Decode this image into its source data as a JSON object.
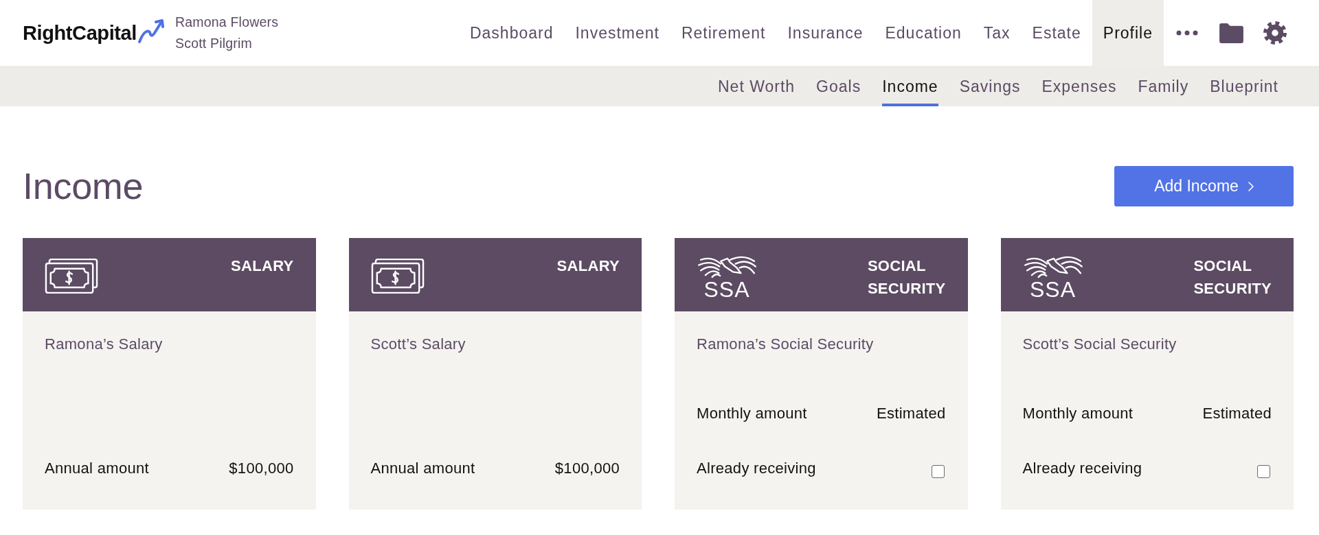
{
  "header": {
    "logo": "RightCapital",
    "clients": [
      "Ramona Flowers",
      "Scott Pilgrim"
    ],
    "nav": [
      {
        "label": "Dashboard",
        "selected": false
      },
      {
        "label": "Investment",
        "selected": false
      },
      {
        "label": "Retirement",
        "selected": false
      },
      {
        "label": "Insurance",
        "selected": false
      },
      {
        "label": "Education",
        "selected": false
      },
      {
        "label": "Tax",
        "selected": false
      },
      {
        "label": "Estate",
        "selected": false
      },
      {
        "label": "Profile",
        "selected": true
      }
    ]
  },
  "subnav": [
    {
      "label": "Net Worth",
      "selected": false
    },
    {
      "label": "Goals",
      "selected": false
    },
    {
      "label": "Income",
      "selected": true
    },
    {
      "label": "Savings",
      "selected": false
    },
    {
      "label": "Expenses",
      "selected": false
    },
    {
      "label": "Family",
      "selected": false
    },
    {
      "label": "Blueprint",
      "selected": false
    }
  ],
  "page": {
    "title": "Income",
    "add_button": "Add Income"
  },
  "cards": [
    {
      "kind": "salary",
      "type_label": "SALARY",
      "name": "Ramona’s Salary",
      "rows": [
        {
          "kind": "value",
          "label": "Annual amount",
          "value": "$100,000"
        }
      ]
    },
    {
      "kind": "salary",
      "type_label": "SALARY",
      "name": "Scott’s Salary",
      "rows": [
        {
          "kind": "value",
          "label": "Annual amount",
          "value": "$100,000"
        }
      ]
    },
    {
      "kind": "social_security",
      "type_label": "SOCIAL SECURITY",
      "logo_text": "SSA",
      "name": "Ramona’s Social Security",
      "rows": [
        {
          "kind": "value",
          "label": "Monthly amount",
          "value": "Estimated"
        },
        {
          "kind": "checkbox",
          "label": "Already receiving",
          "checked": false
        }
      ]
    },
    {
      "kind": "social_security",
      "type_label": "SOCIAL SECURITY",
      "logo_text": "SSA",
      "name": "Scott’s Social Security",
      "rows": [
        {
          "kind": "value",
          "label": "Monthly amount",
          "value": "Estimated"
        },
        {
          "kind": "checkbox",
          "label": "Already receiving",
          "checked": false
        }
      ]
    }
  ]
}
